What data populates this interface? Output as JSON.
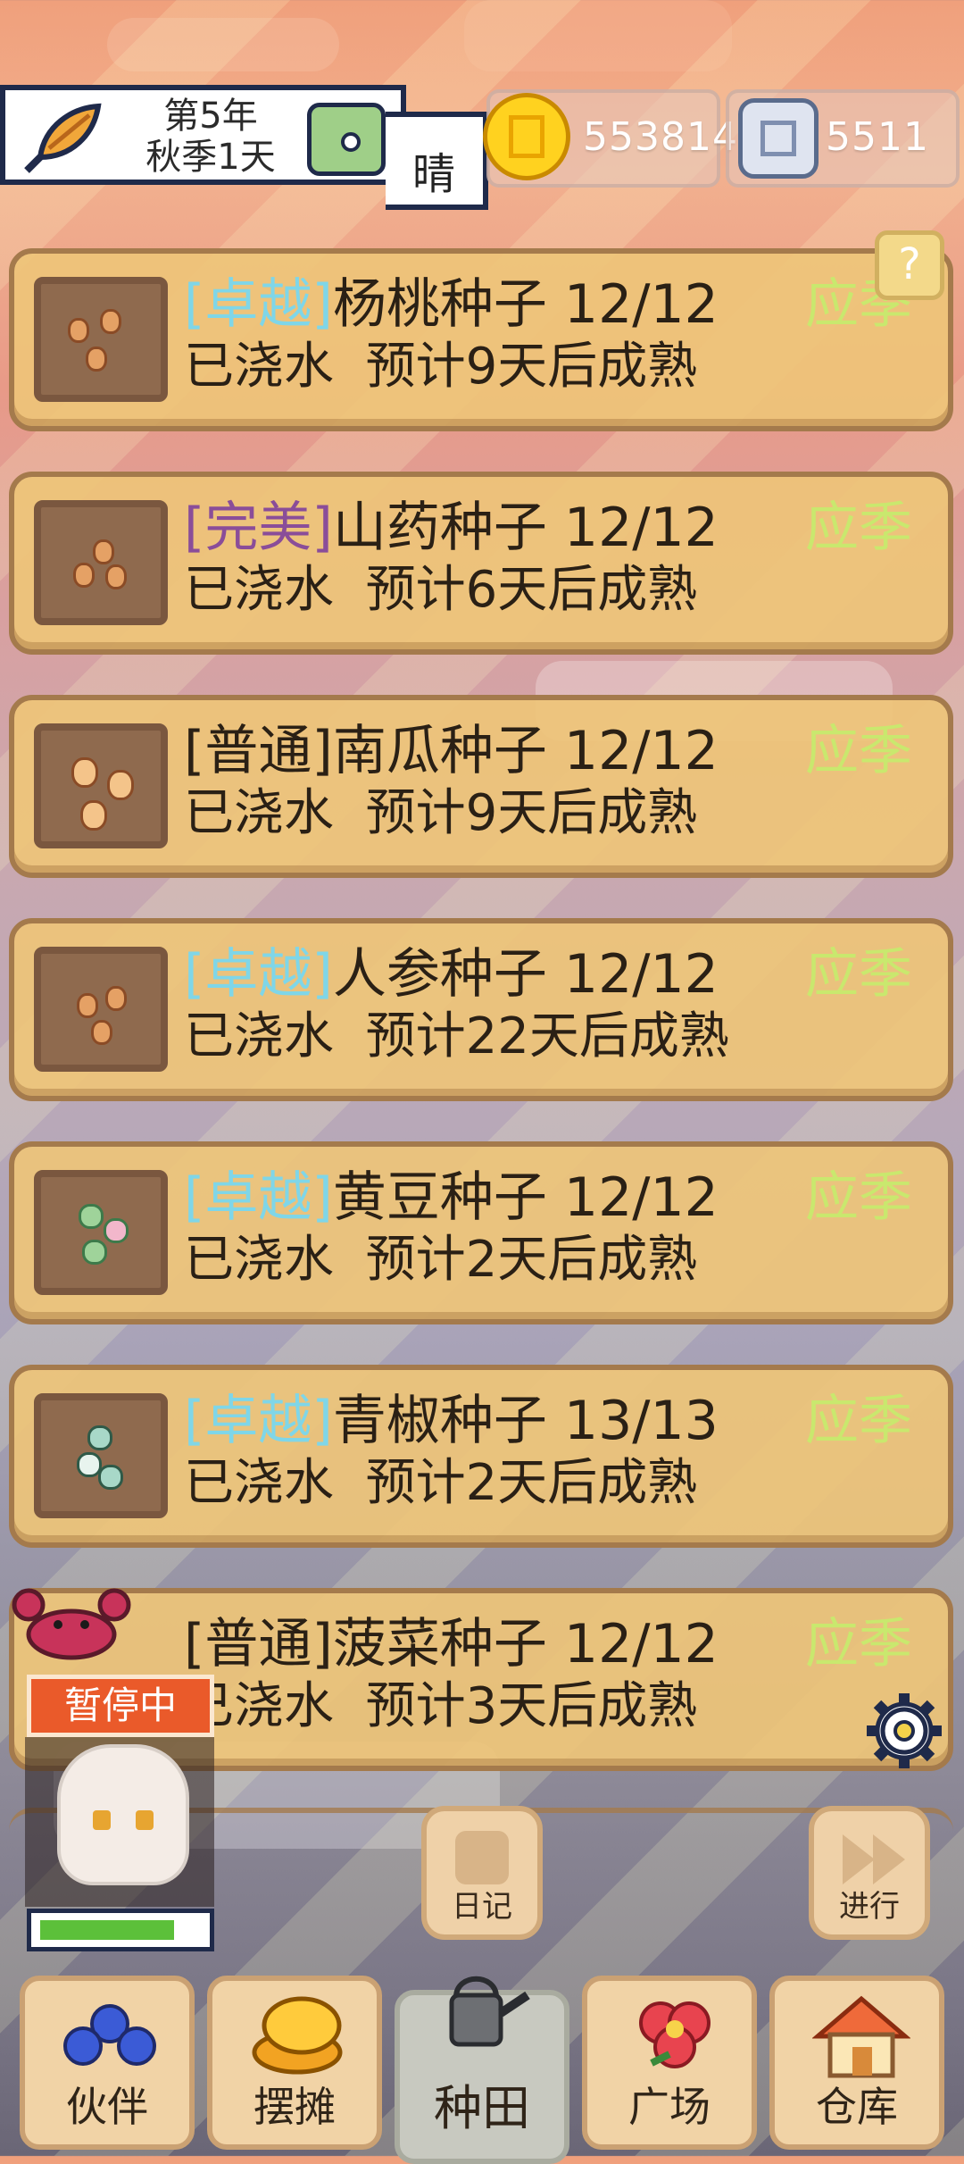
{
  "header": {
    "date_line1": "第5年",
    "date_line2": "秋季1天",
    "weather": "晴",
    "gold": "553814",
    "silver": "5511",
    "help_label": "?"
  },
  "crops": [
    {
      "quality": "[卓越]",
      "quality_type": "excellent",
      "name": "杨桃种子",
      "count": "12/12",
      "season": "应季",
      "status": "已浇水",
      "eta": "预计9天后成熟",
      "seed_color": "#e5a165"
    },
    {
      "quality": "[完美]",
      "quality_type": "perfect",
      "name": "山药种子",
      "count": "12/12",
      "season": "应季",
      "status": "已浇水",
      "eta": "预计6天后成熟",
      "seed_color": "#e39e5a"
    },
    {
      "quality": "[普通]",
      "quality_type": "normal",
      "name": "南瓜种子",
      "count": "12/12",
      "season": "应季",
      "status": "已浇水",
      "eta": "预计9天后成熟",
      "seed_color": "#f4c48a"
    },
    {
      "quality": "[卓越]",
      "quality_type": "excellent",
      "name": "人参种子",
      "count": "12/12",
      "season": "应季",
      "status": "已浇水",
      "eta": "预计22天后成熟",
      "seed_color": "#e39e5a"
    },
    {
      "quality": "[卓越]",
      "quality_type": "excellent",
      "name": "黄豆种子",
      "count": "12/12",
      "season": "应季",
      "status": "已浇水",
      "eta": "预计2天后成熟",
      "seed_color": "#9fd39a"
    },
    {
      "quality": "[卓越]",
      "quality_type": "excellent",
      "name": "青椒种子",
      "count": "13/13",
      "season": "应季",
      "status": "已浇水",
      "eta": "预计2天后成熟",
      "seed_color": "#a8d8c8"
    },
    {
      "quality": "[普通]",
      "quality_type": "normal",
      "name": "菠菜种子",
      "count": "12/12",
      "season": "应季",
      "status": "已浇水",
      "eta": "预计3天后成熟",
      "seed_color": "#9ecf7a"
    }
  ],
  "character": {
    "status_badge": "暂停中",
    "hp_fraction": 0.85
  },
  "actions": {
    "diary": "日记",
    "proceed": "进行"
  },
  "nav": {
    "partner": "伙伴",
    "stall": "摆摊",
    "farm": "种田",
    "plaza": "广场",
    "warehouse": "仓库"
  },
  "colors": {
    "quality_excellent": "#7fd6e8",
    "quality_perfect": "#8a4d99",
    "season": "#c9e86e",
    "paused_badge": "#ea5a2a"
  }
}
